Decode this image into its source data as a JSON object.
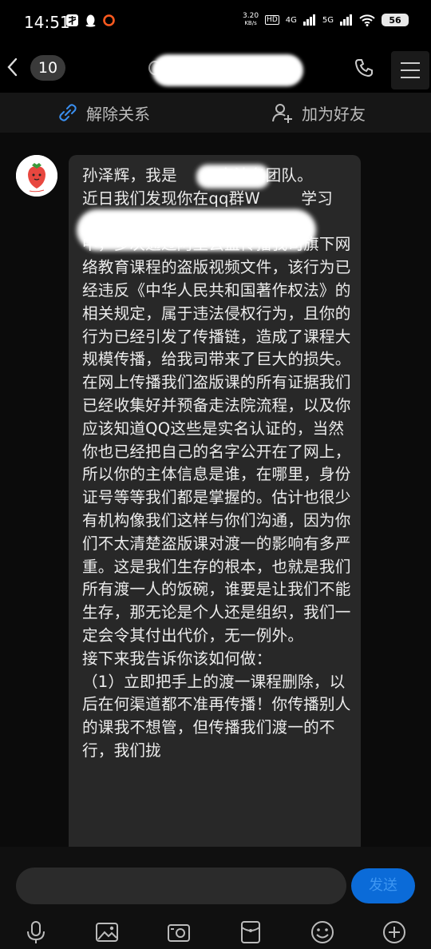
{
  "status_bar": {
    "time": "14:51",
    "net_speed_value": "3.20",
    "net_speed_unit": "KB/s",
    "hd_label": "HD",
    "signal1_label": "4G",
    "signal2_label": "5G",
    "battery": "56"
  },
  "header": {
    "unread_count": "10"
  },
  "actions": {
    "unfriend_label": "解除关系",
    "add_friend_label": "加为好友"
  },
  "message": {
    "text": "孙泽辉，我是        育法务团队。\n近日我们发现你在qq群W        学习\n\n中，多次通过阿里云盘传播我司旗下网络教育课程的盗版视频文件，该行为已经违反《中华人民共和国著作权法》的相关规定，属于违法侵权行为，且你的行为已经引发了传播链，造成了课程大规模传播，给我司带来了巨大的损失。\n在网上传播我们盗版课的所有证据我们已经收集好并预备走法院流程，以及你应该知道QQ这些是实名认证的，当然你也已经把自己的名字公开在了网上，所以你的主体信息是谁，在哪里，身份证号等等我们都是掌握的。估计也很少有机构像我们这样与你们沟通，因为你们不太清楚盗版课对渡一的影响有多严重。这是我们生存的根本，也就是我们所有渡一人的饭碗，谁要是让我们不能生存，那无论是个人还是组织，我们一定会令其付出代价，无一例外。\n接下来我告诉你该如何做：\n（1）立即把手上的渡一课程删除，以后在何渠道都不准再传播！你传播别人的课我不想管，但传播我们渡一的不行，我们拢"
  },
  "input": {
    "placeholder": "",
    "send_label": "发送"
  },
  "colors": {
    "accent": "#0b6bd8",
    "bubble": "#282828",
    "background": "#0b0b0b"
  },
  "icons": [
    "back-icon",
    "phone-icon",
    "menu-icon",
    "unlink-icon",
    "add-user-icon",
    "mic-icon",
    "image-icon",
    "camera-icon",
    "red-packet-icon",
    "emoji-icon",
    "plus-icon"
  ]
}
